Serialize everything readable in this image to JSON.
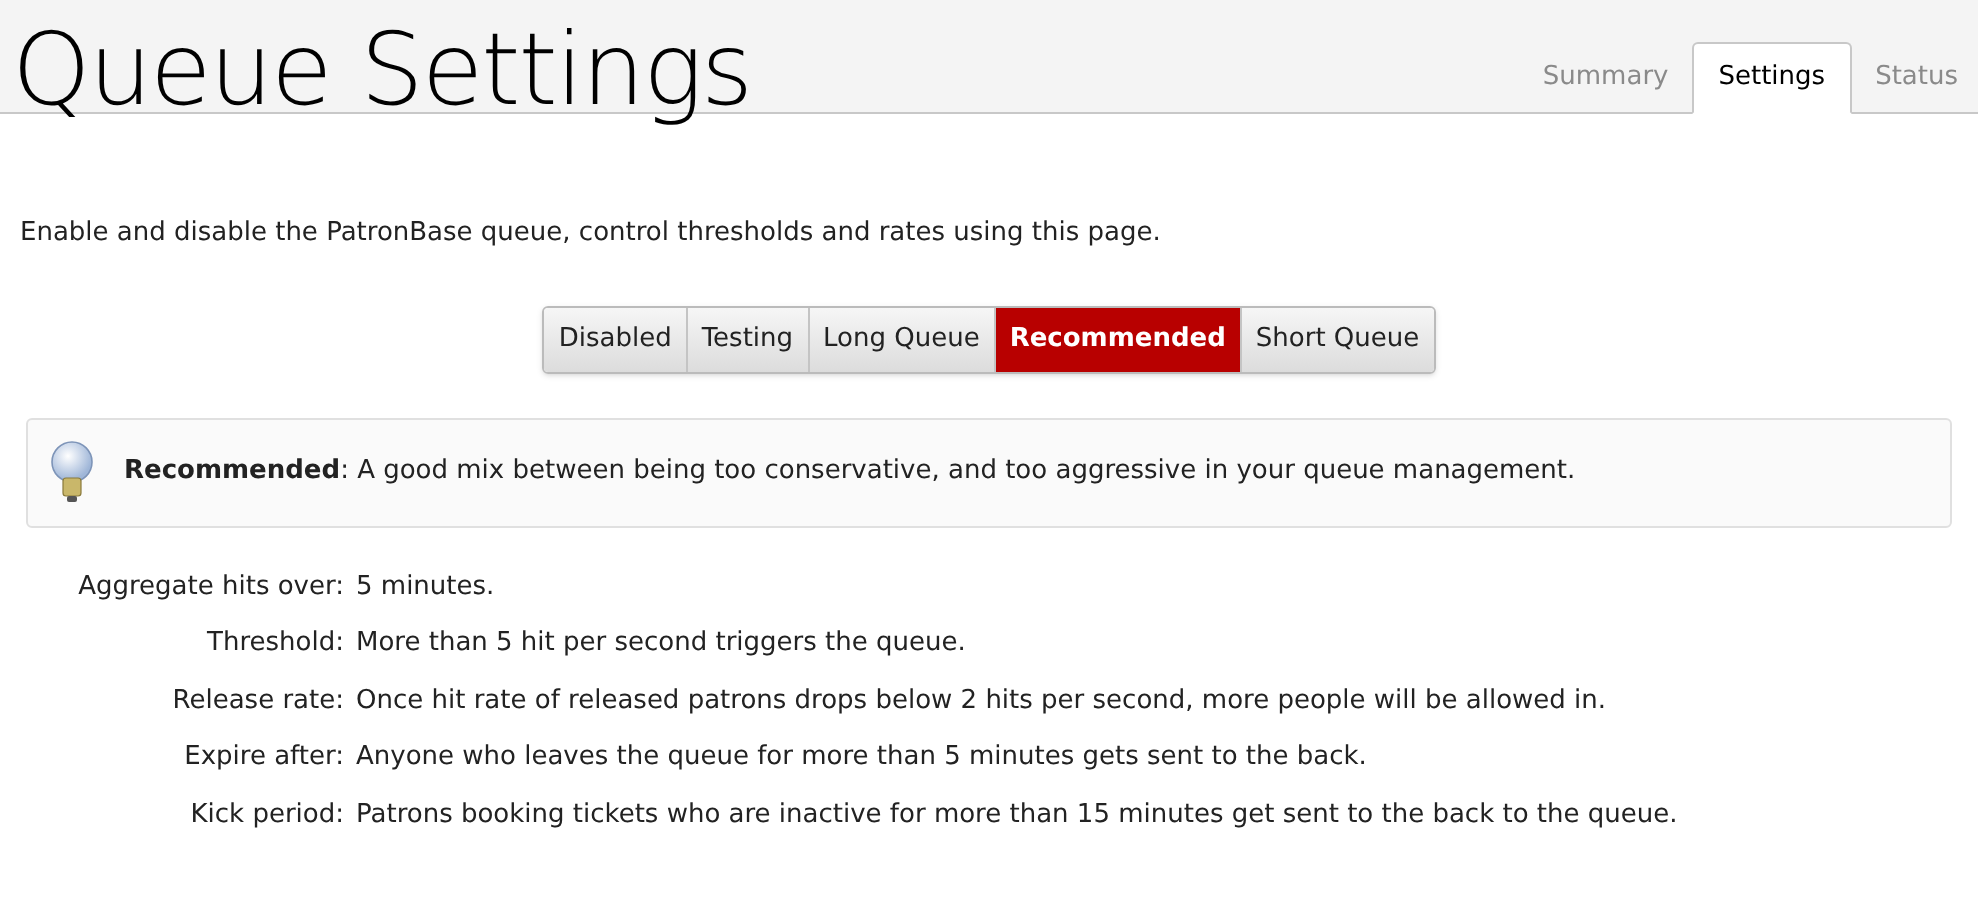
{
  "header": {
    "title": "Queue Settings",
    "tabs": [
      {
        "label": "Summary",
        "selected": false
      },
      {
        "label": "Settings",
        "selected": true
      },
      {
        "label": "Status",
        "selected": false
      }
    ]
  },
  "intro": "Enable and disable the PatronBase queue, control thresholds and rates using this page.",
  "presets": [
    {
      "label": "Disabled",
      "selected": false
    },
    {
      "label": "Testing",
      "selected": false
    },
    {
      "label": "Long Queue",
      "selected": false
    },
    {
      "label": "Recommended",
      "selected": true
    },
    {
      "label": "Short Queue",
      "selected": false
    }
  ],
  "tip": "**Recommended**: A good mix between being too conservative, and too aggressive in your queue management.",
  "settings": [
    {
      "label": "Aggregate hits over:",
      "value": "5 minutes."
    },
    {
      "label": "Threshold:",
      "value": "More than 5 hit per second triggers the queue."
    },
    {
      "label": "Release rate:",
      "value": "Once hit rate of released patrons drops below 2 hits per second, more people will be allowed in."
    },
    {
      "label": "Expire after:",
      "value": "Anyone who leaves the queue for more than 5 minutes gets sent to the back."
    },
    {
      "label": "Kick period:",
      "value": "Patrons booking tickets who are inactive for more than 15 minutes get sent to the back to the queue."
    }
  ]
}
